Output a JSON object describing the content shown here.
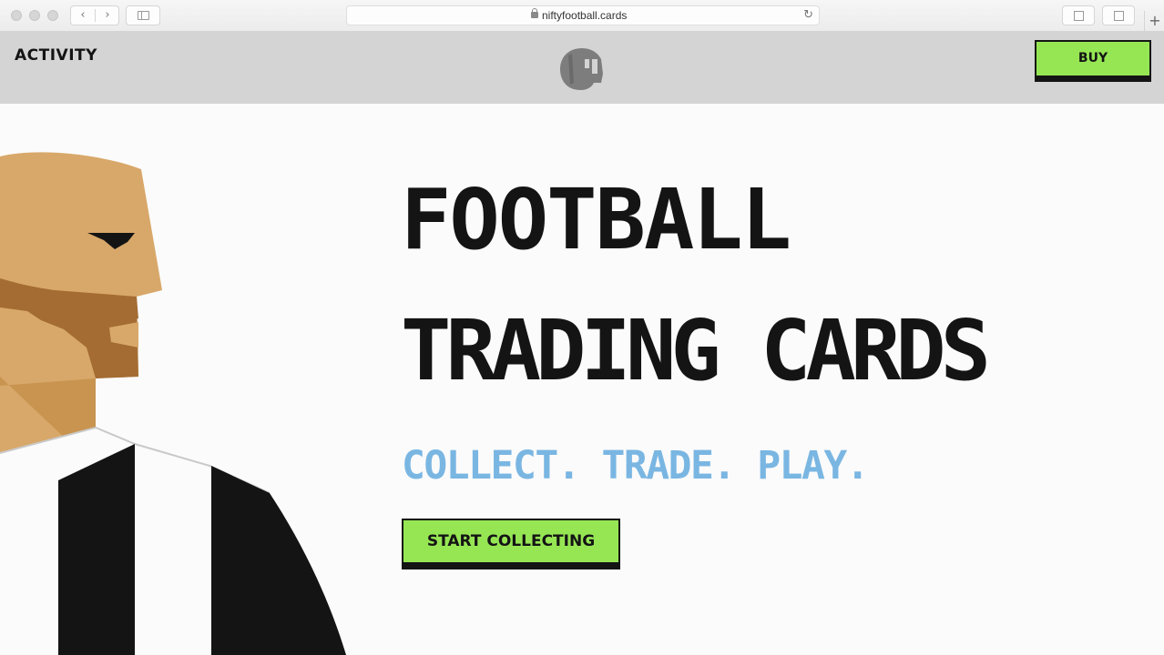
{
  "browser": {
    "url": "niftyfootball.cards",
    "back_glyph": "‹",
    "forward_glyph": "›",
    "reload_glyph": "↻",
    "new_tab_glyph": "+"
  },
  "header": {
    "activity_label": "ACTIVITY",
    "buy_label": "BUY",
    "logo_icon": "helmet-logo-icon"
  },
  "hero": {
    "headline_line1": "FOOTBALL",
    "headline_line2": "TRADING CARDS",
    "tagline": "COLLECT. TRADE. PLAY.",
    "cta_label": "START COLLECTING"
  },
  "colors": {
    "accent_green": "#96e654",
    "tagline_blue": "#7ab6e2",
    "header_gray": "#d4d4d4",
    "ink": "#141414",
    "skin": "#d8a86a",
    "beard": "#a46c32"
  }
}
